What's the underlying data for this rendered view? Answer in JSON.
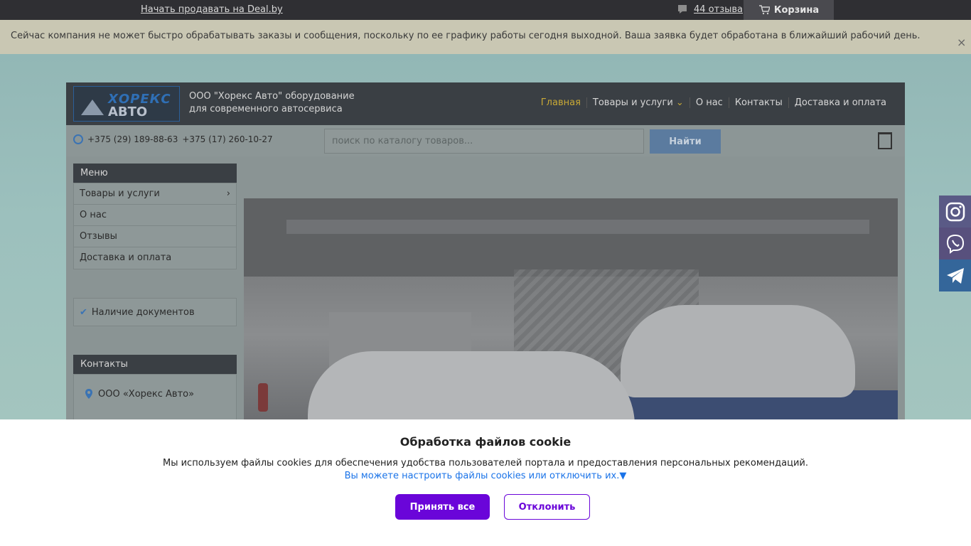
{
  "topbar": {
    "sell_link": "Начать продавать на Deal.by",
    "reviews_link": "44 отзыва",
    "cart_label": "Корзина"
  },
  "notice": {
    "text": "Сейчас компания не может быстро обрабатывать заказы и сообщения, поскольку по ее графику работы сегодня выходной. Ваша заявка будет обработана в ближайший рабочий день.",
    "close_symbol": "×"
  },
  "header": {
    "logo_line1": "ХОРЕКС",
    "logo_line2": "АВТО",
    "tagline": "ООО \"Хорекс Авто\" оборудование для современного автосервиса",
    "nav": [
      "Главная",
      "Товары и услуги",
      "О нас",
      "Контакты",
      "Доставка и оплата"
    ],
    "nav_chevron": "⌄"
  },
  "searchbar": {
    "phone1": "+375 (29) 189-88-63",
    "phone2": "+375 (17) 260-10-27",
    "placeholder": "поиск по каталогу товаров...",
    "button": "Найти"
  },
  "sidebar": {
    "menu_title": "Меню",
    "items": [
      "Товары и услуги",
      "О нас",
      "Отзывы",
      "Доставка и оплата"
    ],
    "submenu_arrow": "›",
    "docs_check": "✔",
    "docs": "Наличие документов",
    "contacts_title": "Контакты",
    "company": "ООО «Хорекс Авто»"
  },
  "cookie": {
    "title": "Обработка файлов cookie",
    "text": "Мы используем файлы cookies для обеспечения удобства пользователей портала и предоставления персональных рекомендаций.",
    "link": "Вы можете настроить файлы cookies или отключить их.▼",
    "accept": "Принять все",
    "reject": "Отклонить"
  }
}
